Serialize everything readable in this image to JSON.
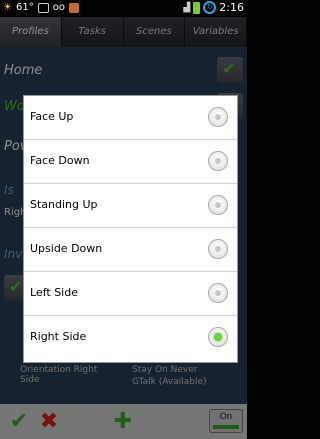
{
  "status_bar": {
    "temperature": "61°",
    "time": "2:16",
    "icons": [
      "weather-icon",
      "gmail-icon",
      "voicemail-icon",
      "app-icon",
      "signal-icon",
      "battery-icon",
      "sync-icon"
    ]
  },
  "tabs": [
    {
      "label": "Profiles",
      "active": true
    },
    {
      "label": "Tasks",
      "active": false
    },
    {
      "label": "Scenes",
      "active": false
    },
    {
      "label": "Variables",
      "active": false
    }
  ],
  "background": {
    "rows": [
      "Home",
      "Wor",
      "Pov"
    ],
    "is_label": "Is",
    "righ_value": "Righ",
    "inv_label": "Inv",
    "orientation_text": "Orientation Right Side",
    "stay_on_text": "Stay On Never",
    "gtalk_text": "GTalk (Available)",
    "toggle_label": "On"
  },
  "dialog": {
    "options": [
      {
        "label": "Face Up",
        "selected": false
      },
      {
        "label": "Face Down",
        "selected": false
      },
      {
        "label": "Standing Up",
        "selected": false
      },
      {
        "label": "Upside Down",
        "selected": false
      },
      {
        "label": "Left Side",
        "selected": false
      },
      {
        "label": "Right Side",
        "selected": true
      }
    ]
  },
  "colors": {
    "accent_green": "#6ad33a",
    "background_blue": "#2a3f5a",
    "tab_bg": "#2c2f35"
  }
}
